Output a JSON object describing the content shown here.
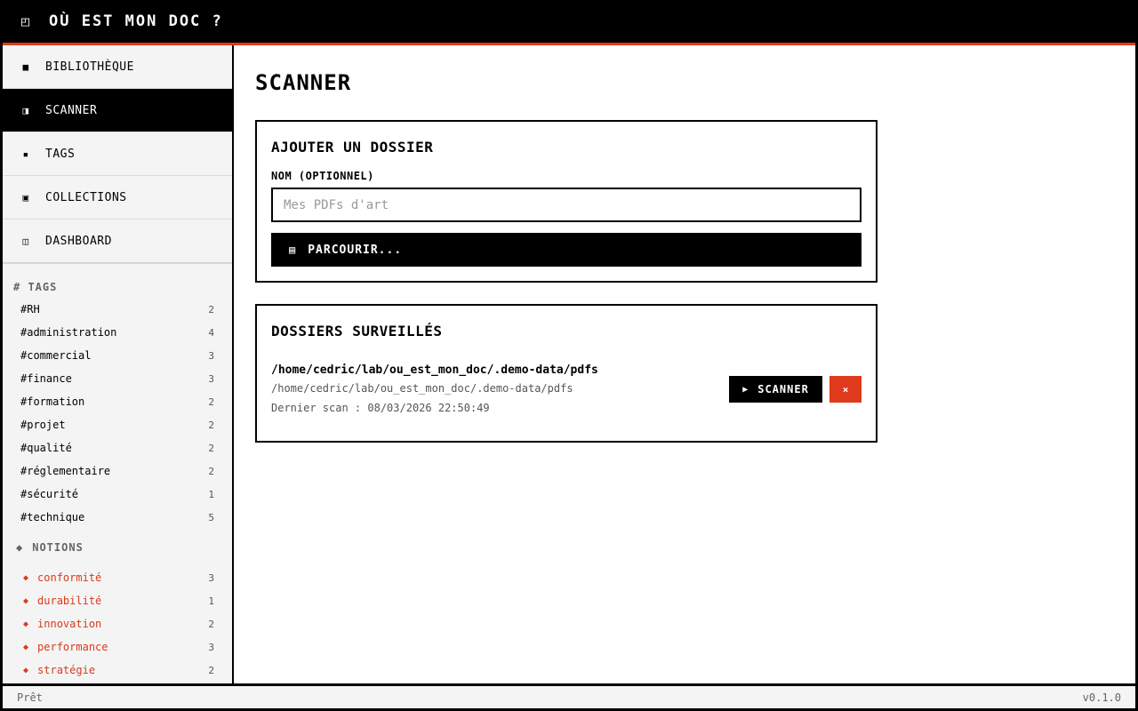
{
  "app": {
    "title": "OÙ EST MON DOC ?",
    "icon": "window-icon"
  },
  "colors": {
    "accent": "#e03a1c",
    "active_bg": "#000000",
    "sidebar_bg": "#f4f4f4"
  },
  "nav": [
    {
      "label": "BIBLIOTHÈQUE",
      "icon": "■",
      "icon_name": "library-icon",
      "active": false
    },
    {
      "label": "SCANNER",
      "icon": "◨",
      "icon_name": "scanner-icon",
      "active": true
    },
    {
      "label": "TAGS",
      "icon": "▪",
      "icon_name": "tag-icon",
      "active": false
    },
    {
      "label": "COLLECTIONS",
      "icon": "▣",
      "icon_name": "collection-icon",
      "active": false
    },
    {
      "label": "DASHBOARD",
      "icon": "◫",
      "icon_name": "dashboard-icon",
      "active": false
    }
  ],
  "tags_section": {
    "title": "# TAGS",
    "items": [
      {
        "label": "#RH",
        "count": "2"
      },
      {
        "label": "#administration",
        "count": "4"
      },
      {
        "label": "#commercial",
        "count": "3"
      },
      {
        "label": "#finance",
        "count": "3"
      },
      {
        "label": "#formation",
        "count": "2"
      },
      {
        "label": "#projet",
        "count": "2"
      },
      {
        "label": "#qualité",
        "count": "2"
      },
      {
        "label": "#réglementaire",
        "count": "2"
      },
      {
        "label": "#sécurité",
        "count": "1"
      },
      {
        "label": "#technique",
        "count": "5"
      }
    ]
  },
  "notions_section": {
    "icon": "◆",
    "title": "NOTIONS",
    "items": [
      {
        "label": "conformité",
        "count": "3"
      },
      {
        "label": "durabilité",
        "count": "1"
      },
      {
        "label": "innovation",
        "count": "2"
      },
      {
        "label": "performance",
        "count": "3"
      },
      {
        "label": "stratégie",
        "count": "2"
      }
    ]
  },
  "main": {
    "title": "SCANNER",
    "add_folder": {
      "title": "AJOUTER UN DOSSIER",
      "name_label": "NOM (OPTIONNEL)",
      "name_value": "",
      "name_placeholder": "Mes PDFs d'art",
      "browse_icon": "▤",
      "browse_label": "PARCOURIR..."
    },
    "watched": {
      "title": "DOSSIERS SURVEILLÉS",
      "folders": [
        {
          "name": "/home/cedric/lab/ou_est_mon_doc/.demo-data/pdfs",
          "path": "/home/cedric/lab/ou_est_mon_doc/.demo-data/pdfs",
          "last_scan": "Dernier scan : 08/03/2026 22:50:49",
          "scan_icon": "▶",
          "scan_label": "SCANNER",
          "remove_label": "×"
        }
      ]
    }
  },
  "status": {
    "text": "Prêt",
    "version": "v0.1.0"
  }
}
